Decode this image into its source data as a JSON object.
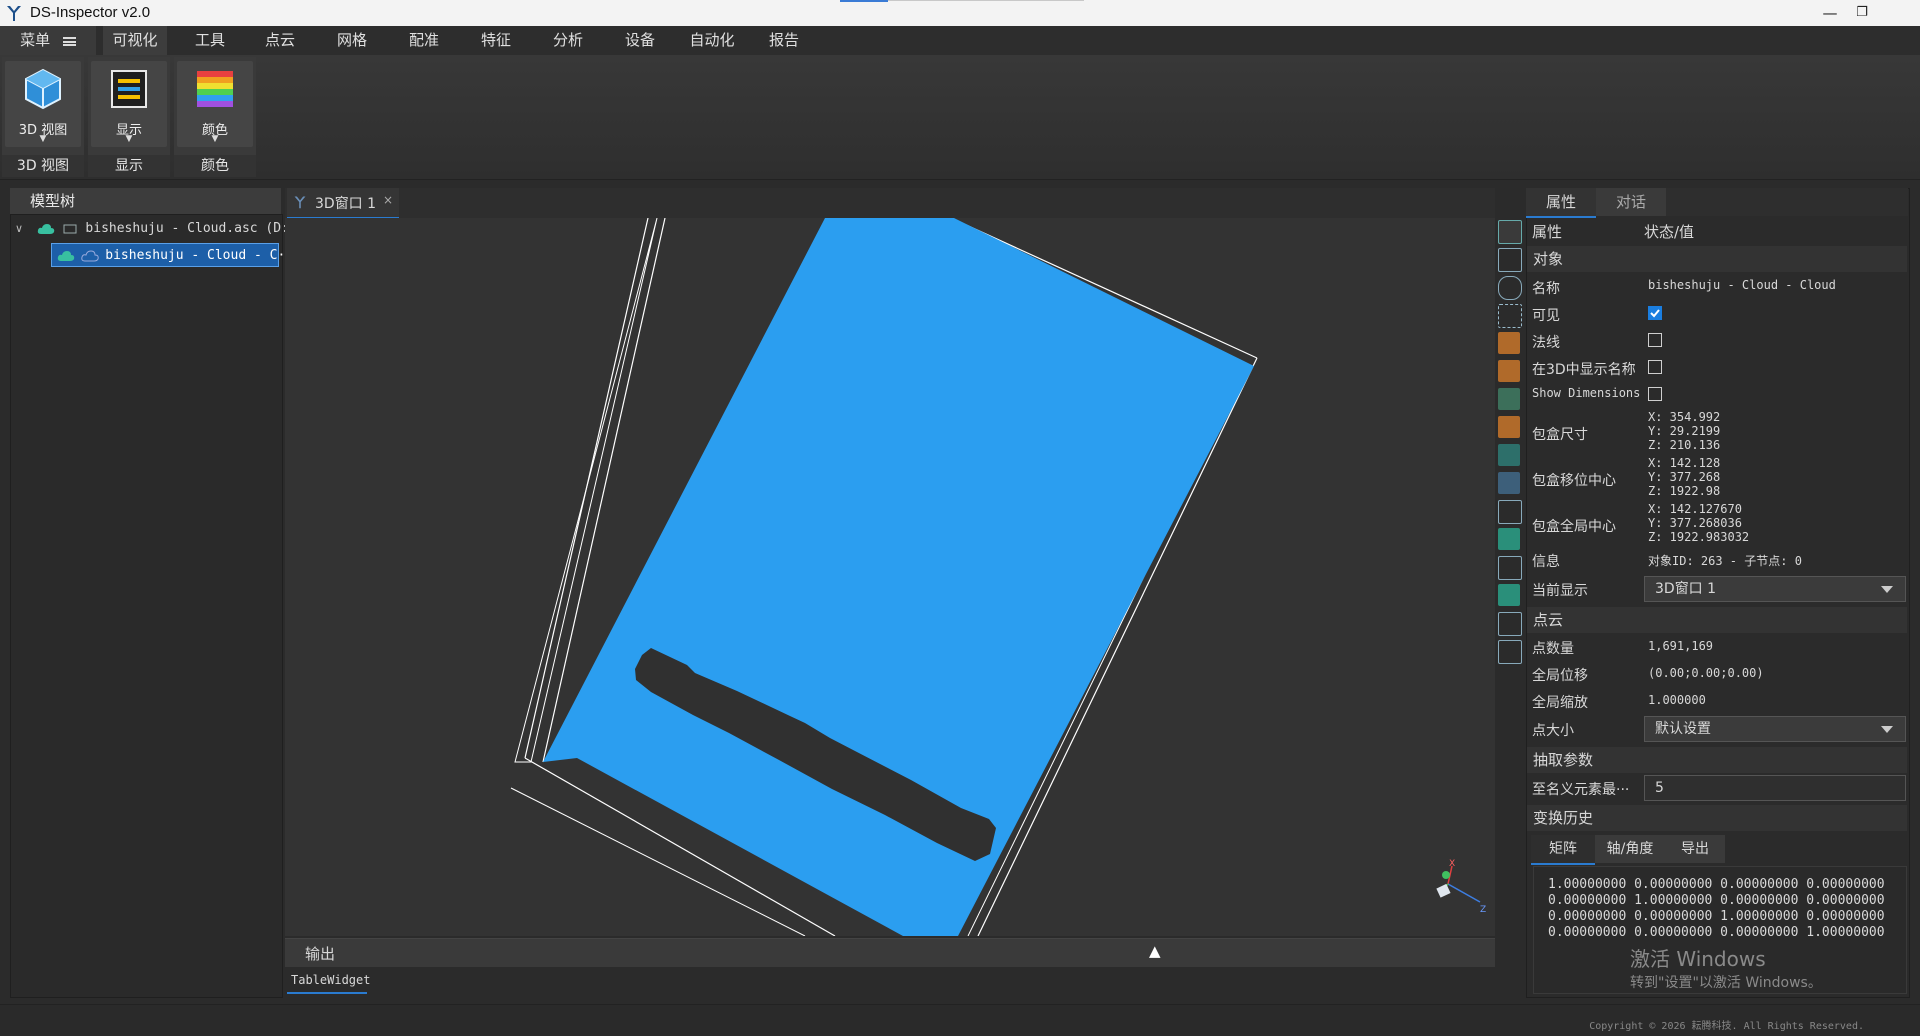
{
  "app": {
    "title": "DS-Inspector v2.0",
    "minimize": "—",
    "restore": "❐"
  },
  "menubar": {
    "main": "菜单",
    "items": [
      "可视化",
      "工具",
      "点云",
      "网格",
      "配准",
      "特征",
      "分析",
      "设备",
      "自动化",
      "报告"
    ]
  },
  "ribbon": {
    "groups": [
      {
        "button": "3D 视图",
        "label": "3D 视图",
        "icon": "cube-icon"
      },
      {
        "button": "显示",
        "label": "显示",
        "icon": "display-icon"
      },
      {
        "button": "颜色",
        "label": "颜色",
        "icon": "color-icon"
      }
    ]
  },
  "tree": {
    "title": "模型树",
    "root": "bisheshuju - Cloud.asc (D:/)",
    "child": "bisheshuju - Cloud - C···"
  },
  "view": {
    "tab": "3D窗口 1",
    "axis_x": "X",
    "axis_z": "Z"
  },
  "output": {
    "title": "输出",
    "tab": "TableWidget"
  },
  "properties": {
    "tabs": [
      "属性",
      "对话"
    ],
    "header": {
      "property": "属性",
      "value": "状态/值"
    },
    "object_section": "对象",
    "name_label": "名称",
    "name_value": "bisheshuju - Cloud - Cloud",
    "visible_label": "可见",
    "visible_checked": true,
    "normals_label": "法线",
    "show_name_label": "在3D中显示名称",
    "show_dims_label": "Show Dimensions",
    "bbox_size_label": "包盒尺寸",
    "bbox_size": [
      "X: 354.992",
      "Y: 29.2199",
      "Z: 210.136"
    ],
    "bbox_shift_center_label": "包盒移位中心",
    "bbox_shift_center": [
      "X: 142.128",
      "Y: 377.268",
      "Z: 1922.98"
    ],
    "bbox_global_center_label": "包盒全局中心",
    "bbox_global_center": [
      "X: 142.127670",
      "Y: 377.268036",
      "Z: 1922.983032"
    ],
    "info_label": "信息",
    "info_value": "对象ID: 263 - 子节点: 0",
    "current_display_label": "当前显示",
    "current_display_value": "3D窗口 1",
    "cloud_section": "点云",
    "point_count_label": "点数量",
    "point_count": "1,691,169",
    "global_shift_label": "全局位移",
    "global_shift": "(0.00;0.00;0.00)",
    "global_scale_label": "全局缩放",
    "global_scale": "1.000000",
    "point_size_label": "点大小",
    "point_size": "默认设置",
    "sf_section": "抽取参数",
    "sf_label": "至名义元素最···",
    "sf_value": "5",
    "transform_section": "变换历史",
    "transform_tabs": [
      "矩阵",
      "轴/角度",
      "导出"
    ],
    "matrix": [
      "1.00000000 0.00000000 0.00000000 0.00000000",
      "0.00000000 1.00000000 0.00000000 0.00000000",
      "0.00000000 0.00000000 1.00000000 0.00000000",
      "0.00000000 0.00000000 0.00000000 1.00000000"
    ],
    "watermark_line1": "激活 Windows",
    "watermark_line2": "转到\"设置\"以激活 Windows。"
  },
  "status": {
    "copyright": "Copyright © 2026 耘腾科技. All Rights Reserved."
  },
  "colors": {
    "accent": "#2a7bd0",
    "cloud": "#2b9ef0",
    "background": "#2b2b2b"
  }
}
